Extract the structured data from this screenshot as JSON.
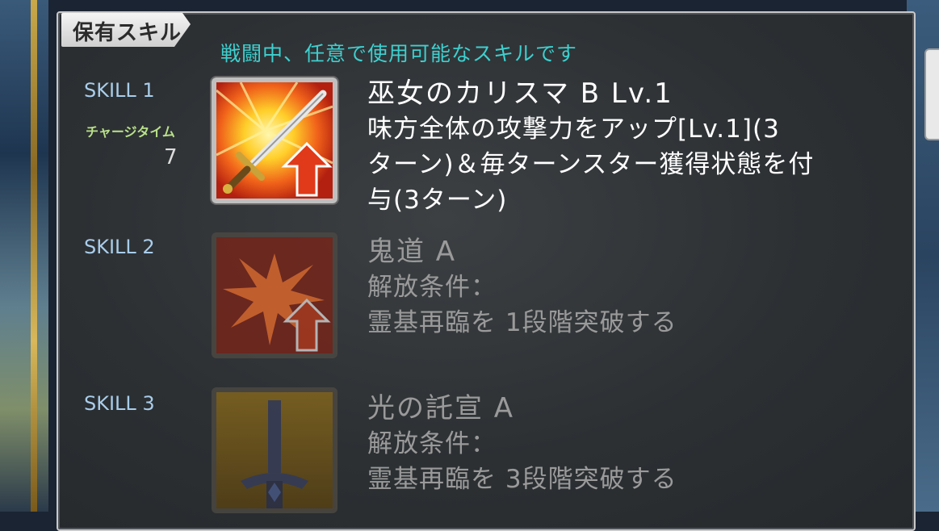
{
  "header": {
    "tab_label": "保有スキル",
    "subtitle": "戦闘中、任意で使用可能なスキルです"
  },
  "skills": [
    {
      "label": "SKILL 1",
      "charge_label": "チャージタイム",
      "charge_value": "7",
      "name": "巫女のカリスマ B Lv.1",
      "desc_lines": [
        "味方全体の攻撃力をアップ[Lv.1](3",
        "ターン)＆毎ターンスター獲得状態を付",
        "与(3ターン)"
      ],
      "icon": "sword-attack-up-icon",
      "state": "unlocked"
    },
    {
      "label": "SKILL 2",
      "name": "鬼道 A",
      "desc_lines": [
        "解放条件：",
        "霊基再臨を 1段階突破する"
      ],
      "icon": "burst-attack-up-icon",
      "state": "locked"
    },
    {
      "label": "SKILL 3",
      "name": "光の託宣 A",
      "desc_lines": [
        "解放条件：",
        "霊基再臨を 3段階突破する"
      ],
      "icon": "sword-down-icon",
      "state": "locked"
    }
  ],
  "colors": {
    "subtitle": "#3ed0cf",
    "skill_label": "#a9cdea",
    "charge_label": "#b9e08a",
    "locked_text": "#9a9a9a"
  }
}
